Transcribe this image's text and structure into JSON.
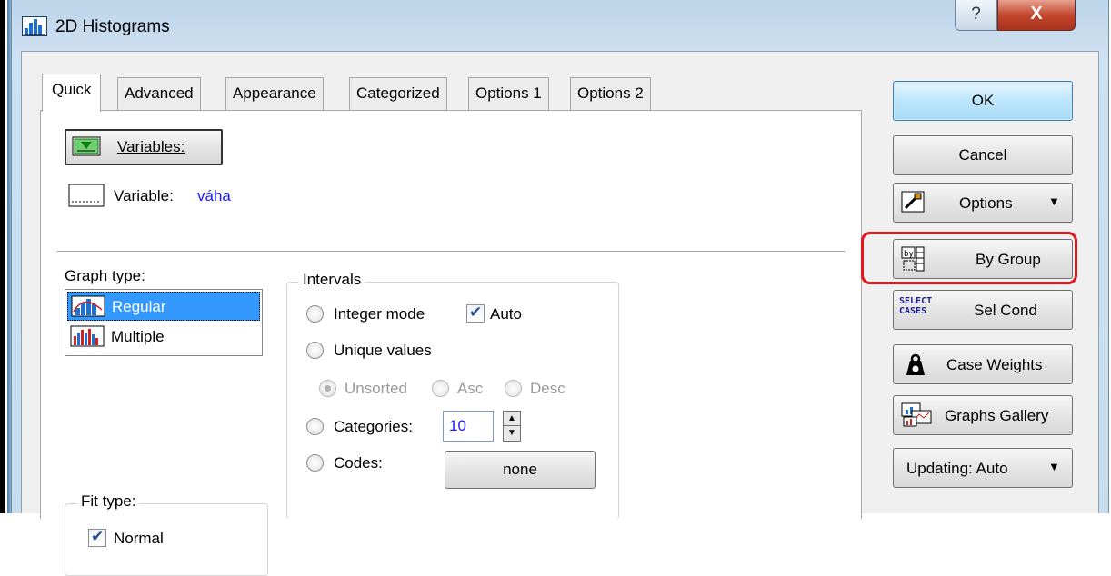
{
  "window": {
    "title": "2D Histograms",
    "help_glyph": "?",
    "close_glyph": "X"
  },
  "tabs": [
    {
      "label": "Quick"
    },
    {
      "label": "Advanced"
    },
    {
      "label": "Appearance"
    },
    {
      "label": "Categorized"
    },
    {
      "label": "Options 1"
    },
    {
      "label": "Options 2"
    }
  ],
  "quick": {
    "variables_button": "Variables:",
    "variable_label": "Variable:",
    "variable_value": "váha",
    "variable_value_color": "#1a1aff",
    "graph_type": {
      "title": "Graph type:",
      "items": [
        {
          "label": "Regular",
          "selected": true
        },
        {
          "label": "Multiple",
          "selected": false
        }
      ],
      "selected_color": "#3399ff"
    },
    "fit_type": {
      "title": "Fit type:",
      "normal_label": "Normal",
      "normal_checked": true
    },
    "intervals": {
      "title": "Intervals",
      "integer_mode": "Integer mode",
      "auto_label": "Auto",
      "auto_checked": true,
      "unique_values": "Unique values",
      "unsorted": "Unsorted",
      "asc": "Asc",
      "desc": "Desc",
      "categories_label": "Categories:",
      "categories_value": "10",
      "codes_label": "Codes:",
      "codes_button": "none"
    }
  },
  "side_buttons": {
    "ok": "OK",
    "cancel": "Cancel",
    "options": "Options",
    "by_group": "By Group",
    "sel_cond": "Sel Cond",
    "sel_cond_icon_text": "SELECT CASES",
    "case_weights": "Case Weights",
    "graphs_gallery": "Graphs Gallery",
    "updating": "Updating: Auto"
  },
  "highlight_color": "#e8141b"
}
